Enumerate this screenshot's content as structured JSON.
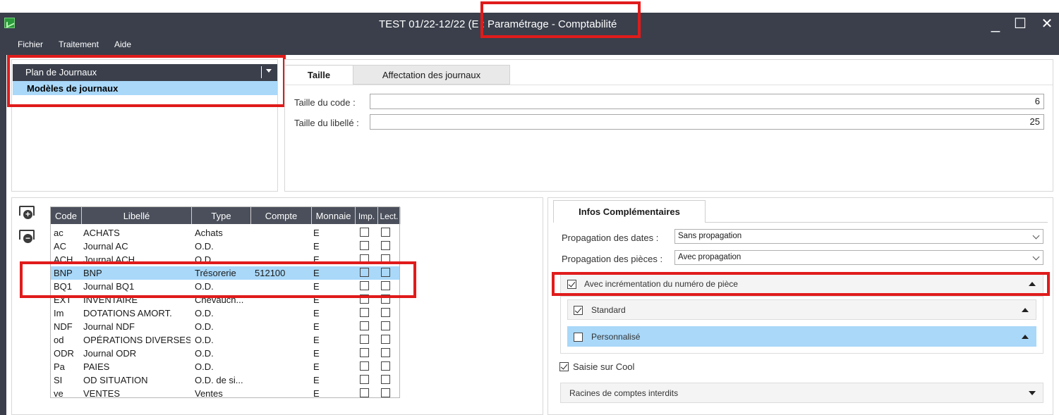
{
  "window": {
    "title": "TEST 01/22-12/22 (E : Paramétrage - Comptabilité",
    "minimize": "_",
    "maximize": "☐",
    "close": "✕"
  },
  "menu": [
    "Fichier",
    "Traitement",
    "Aide"
  ],
  "plan": {
    "combo_label": "Plan de Journaux",
    "selected_item": "Modèles de journaux"
  },
  "tabs_top": {
    "active": "Taille",
    "inactive": "Affectation des journaux"
  },
  "taille": {
    "code_label": "Taille du code :",
    "code_value": "6",
    "libelle_label": "Taille du libellé :",
    "libelle_value": "25"
  },
  "grid": {
    "headers": [
      "Code",
      "Libellé",
      "Type",
      "Compte",
      "Monnaie",
      "Imp.",
      "Lect."
    ],
    "rows": [
      {
        "code": "ac",
        "libelle": "ACHATS",
        "type": "Achats",
        "compte": "",
        "monnaie": "E"
      },
      {
        "code": "AC",
        "libelle": "Journal AC",
        "type": "O.D.",
        "compte": "",
        "monnaie": "E"
      },
      {
        "code": "ACH",
        "libelle": "Journal ACH",
        "type": "O.D.",
        "compte": "",
        "monnaie": "E"
      },
      {
        "code": "BNP",
        "libelle": "BNP",
        "type": "Trésorerie",
        "compte": "512100",
        "monnaie": "E"
      },
      {
        "code": "BQ1",
        "libelle": "Journal BQ1",
        "type": "O.D.",
        "compte": "",
        "monnaie": "E"
      },
      {
        "code": "EXT",
        "libelle": "INVENTAIRE",
        "type": "Chevauch...",
        "compte": "",
        "monnaie": "E"
      },
      {
        "code": "Im",
        "libelle": "DOTATIONS AMORT.",
        "type": "O.D.",
        "compte": "",
        "monnaie": "E"
      },
      {
        "code": "NDF",
        "libelle": "Journal NDF",
        "type": "O.D.",
        "compte": "",
        "monnaie": "E"
      },
      {
        "code": "od",
        "libelle": "OPÉRATIONS DIVERSES",
        "type": "O.D.",
        "compte": "",
        "monnaie": "E"
      },
      {
        "code": "ODR",
        "libelle": "Journal ODR",
        "type": "O.D.",
        "compte": "",
        "monnaie": "E"
      },
      {
        "code": "Pa",
        "libelle": "PAIES",
        "type": "O.D.",
        "compte": "",
        "monnaie": "E"
      },
      {
        "code": "SI",
        "libelle": "OD SITUATION",
        "type": "O.D. de si...",
        "compte": "",
        "monnaie": "E"
      },
      {
        "code": "ve",
        "libelle": "VENTES",
        "type": "Ventes",
        "compte": "",
        "monnaie": "E"
      }
    ]
  },
  "infos": {
    "tab_label": "Infos Complémentaires",
    "dates_label": "Propagation des dates :",
    "dates_value": "Sans propagation",
    "pieces_label": "Propagation des pièces :",
    "pieces_value": "Avec propagation",
    "increment_label": "Avec incrémentation du numéro de pièce",
    "standard_label": "Standard",
    "perso_label": "Personnalisé",
    "saisie_label": "Saisie sur Cool",
    "racines_label": "Racines de comptes interdits"
  },
  "colors": {
    "titlebar": "#3a3f4b",
    "selection": "#a9d8f9",
    "highlight_box": "#e01b1b"
  }
}
